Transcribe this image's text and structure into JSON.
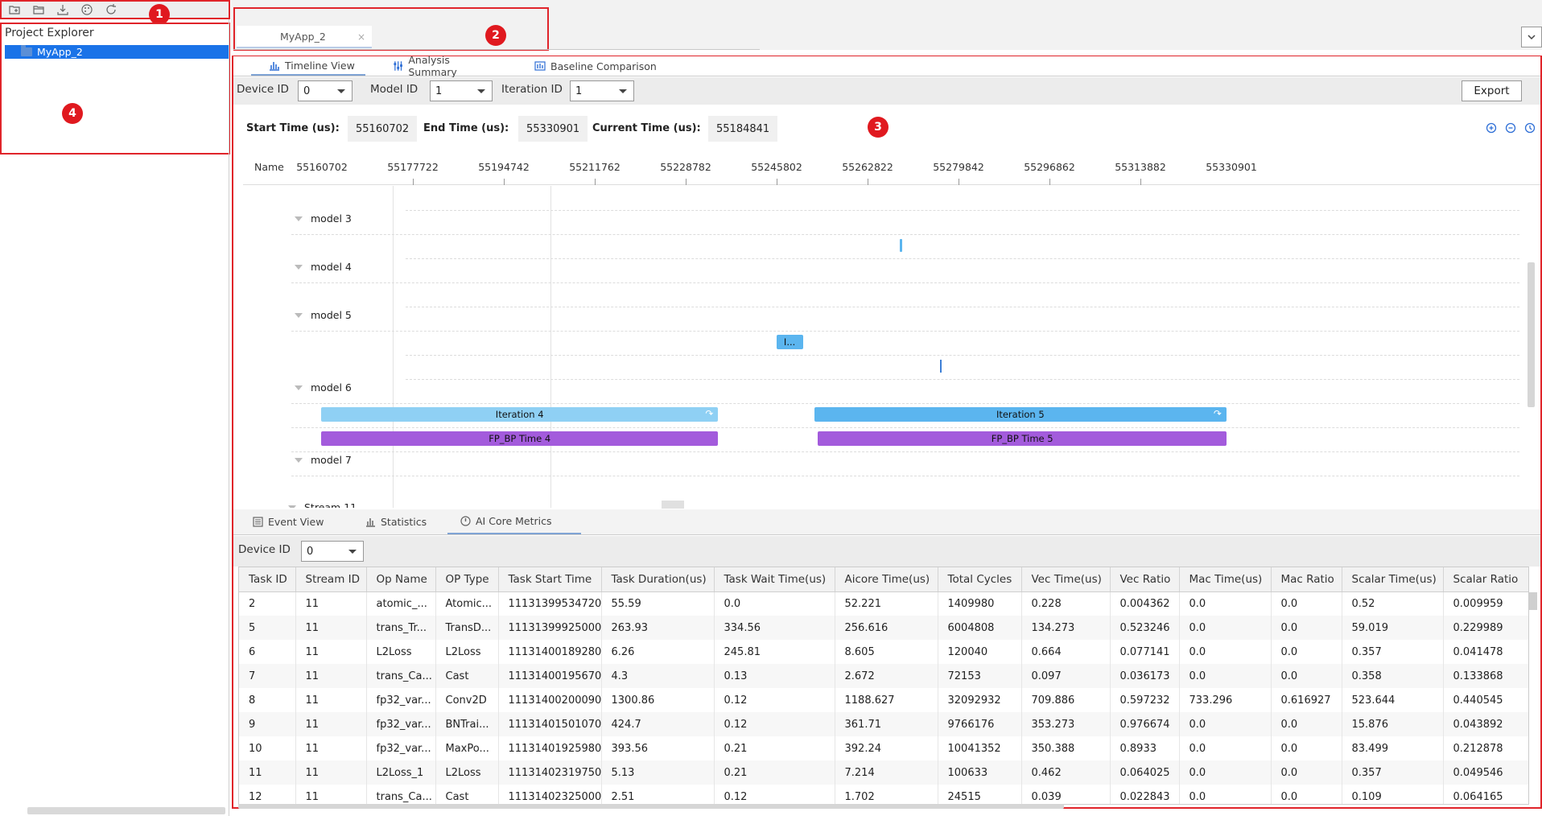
{
  "toolbar": {
    "icons": [
      "new-project-icon",
      "open-folder-icon",
      "import-icon",
      "theme-icon",
      "refresh-icon"
    ]
  },
  "explorer": {
    "title": "Project Explorer",
    "items": [
      {
        "label": "MyApp_2",
        "selected": true
      }
    ]
  },
  "editor": {
    "tab_label": "MyApp_2",
    "tab_close": "×"
  },
  "badges": [
    "1",
    "2",
    "3",
    "4"
  ],
  "view_tabs": [
    {
      "label": "Timeline View",
      "active": true
    },
    {
      "label": "Analysis Summary",
      "active": false
    },
    {
      "label": "Baseline Comparison",
      "active": false
    }
  ],
  "filters": {
    "device_label": "Device ID",
    "device_value": "0",
    "model_label": "Model ID",
    "model_value": "1",
    "iteration_label": "Iteration ID",
    "iteration_value": "1",
    "export_label": "Export"
  },
  "times": {
    "start_label": "Start Time (us):",
    "start_value": "55160702",
    "end_label": "End Time (us):",
    "end_value": "55330901",
    "current_label": "Current Time (us):",
    "current_value": "55184841"
  },
  "timeline": {
    "name_header": "Name",
    "ticks": [
      "55160702",
      "55177722",
      "55194742",
      "55211762",
      "55228782",
      "55245802",
      "55262822",
      "55279842",
      "55296862",
      "55313882",
      "55330901"
    ],
    "rows": [
      "model 3",
      "model 4",
      "model 5",
      "model 6",
      "model 7",
      "Stream 11"
    ],
    "bars": [
      {
        "label": "I...",
        "start": 55245802,
        "end": 55250800,
        "color": "#5bb5ef"
      },
      {
        "label": "Iteration 4",
        "start": 55160702,
        "end": 55234950,
        "color": "#8fd0f4"
      },
      {
        "label": "Iteration 5",
        "start": 55252900,
        "end": 55330000,
        "color": "#5bb5ef"
      },
      {
        "label": "FP_BP Time 4",
        "start": 55160702,
        "end": 55234950,
        "color": "#a35bdc"
      },
      {
        "label": "FP_BP Time 5",
        "start": 55253600,
        "end": 55330000,
        "color": "#a35bdc"
      }
    ]
  },
  "bottom_tabs": [
    {
      "label": "Event View",
      "active": false
    },
    {
      "label": "Statistics",
      "active": false
    },
    {
      "label": "AI Core Metrics",
      "active": true
    }
  ],
  "bottom_filter": {
    "device_label": "Device ID",
    "device_value": "0"
  },
  "table": {
    "columns": [
      "Task ID",
      "Stream ID",
      "Op Name",
      "OP Type",
      "Task Start Time",
      "Task Duration(us)",
      "Task Wait Time(us)",
      "Aicore Time(us)",
      "Total Cycles",
      "Vec Time(us)",
      "Vec Ratio",
      "Mac Time(us)",
      "Mac Ratio",
      "Scalar Time(us)",
      "Scalar Ratio"
    ],
    "rows": [
      [
        "2",
        "11",
        "atomic_...",
        "Atomic...",
        "11131399534720",
        "55.59",
        "0.0",
        "52.221",
        "1409980",
        "0.228",
        "0.004362",
        "0.0",
        "0.0",
        "0.52",
        "0.009959"
      ],
      [
        "5",
        "11",
        "trans_Tr...",
        "TransD...",
        "11131399925000",
        "263.93",
        "334.56",
        "256.616",
        "6004808",
        "134.273",
        "0.523246",
        "0.0",
        "0.0",
        "59.019",
        "0.229989"
      ],
      [
        "6",
        "11",
        "L2Loss",
        "L2Loss",
        "11131400189280",
        "6.26",
        "245.81",
        "8.605",
        "120040",
        "0.664",
        "0.077141",
        "0.0",
        "0.0",
        "0.357",
        "0.041478"
      ],
      [
        "7",
        "11",
        "trans_Ca...",
        "Cast",
        "11131400195670",
        "4.3",
        "0.13",
        "2.672",
        "72153",
        "0.097",
        "0.036173",
        "0.0",
        "0.0",
        "0.358",
        "0.133868"
      ],
      [
        "8",
        "11",
        "fp32_var...",
        "Conv2D",
        "11131400200090",
        "1300.86",
        "0.12",
        "1188.627",
        "32092932",
        "709.886",
        "0.597232",
        "733.296",
        "0.616927",
        "523.644",
        "0.440545"
      ],
      [
        "9",
        "11",
        "fp32_var...",
        "BNTrai...",
        "11131401501070",
        "424.7",
        "0.12",
        "361.71",
        "9766176",
        "353.273",
        "0.976674",
        "0.0",
        "0.0",
        "15.876",
        "0.043892"
      ],
      [
        "10",
        "11",
        "fp32_var...",
        "MaxPo...",
        "11131401925980",
        "393.56",
        "0.21",
        "392.24",
        "10041352",
        "350.388",
        "0.8933",
        "0.0",
        "0.0",
        "83.499",
        "0.212878"
      ],
      [
        "11",
        "11",
        "L2Loss_1",
        "L2Loss",
        "11131402319750",
        "5.13",
        "0.21",
        "7.214",
        "100633",
        "0.462",
        "0.064025",
        "0.0",
        "0.0",
        "0.357",
        "0.049546"
      ],
      [
        "12",
        "11",
        "trans_Ca...",
        "Cast",
        "11131402325000",
        "2.51",
        "0.12",
        "1.702",
        "24515",
        "0.039",
        "0.022843",
        "0.0",
        "0.0",
        "0.109",
        "0.064165"
      ]
    ]
  }
}
